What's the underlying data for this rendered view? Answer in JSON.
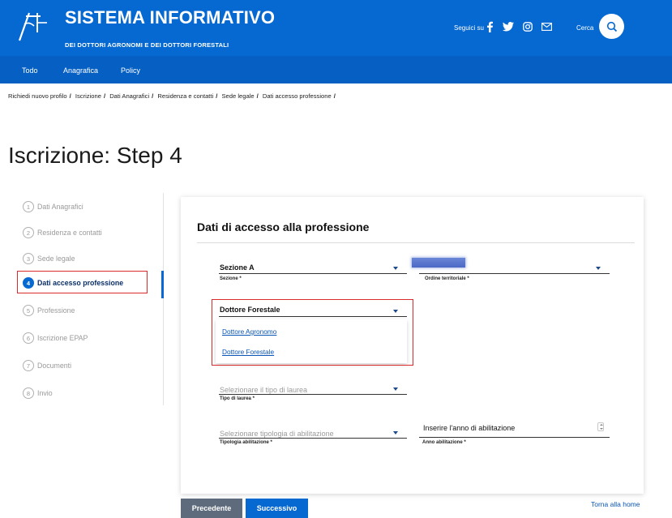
{
  "header": {
    "title": "SISTEMA INFORMATIVO",
    "subtitle": "DEI DOTTORI AGRONOMI E DEI DOTTORI FORESTALI",
    "social_label": "Seguici su",
    "social_icons": [
      "facebook-icon",
      "twitter-icon",
      "instagram-icon",
      "mail-icon"
    ],
    "search_label": "Cerca",
    "search_icon": "search-icon",
    "nav": [
      "Todo",
      "Anagrafica",
      "Policy"
    ],
    "colors": {
      "brand": "#0668d1",
      "nav": "#0660c4"
    }
  },
  "breadcrumb": [
    "Richiedi nuovo profilo",
    "Iscrizione",
    "Dati Anagrafici",
    "Residenza e contatti",
    "Sede legale",
    "Dati accesso professione"
  ],
  "page_title": "Iscrizione: Step 4",
  "stepper": {
    "active_index": 3,
    "steps": [
      {
        "num": "1",
        "label": "Dati Anagrafici"
      },
      {
        "num": "2",
        "label": "Residenza e contatti"
      },
      {
        "num": "3",
        "label": "Sede legale"
      },
      {
        "num": "4",
        "label": "Dati accesso professione"
      },
      {
        "num": "5",
        "label": "Professione"
      },
      {
        "num": "6",
        "label": "Iscrizione EPAP"
      },
      {
        "num": "7",
        "label": "Documenti"
      },
      {
        "num": "8",
        "label": "Invio"
      }
    ]
  },
  "form": {
    "title": "Dati di accesso alla professione",
    "sezione": {
      "value": "Sezione A",
      "label": "Sezione *"
    },
    "ordine": {
      "value": "",
      "label": "Ordine territoriale *"
    },
    "titolo": {
      "value": "Dottore Forestale",
      "options": [
        "Dottore Agronomo",
        "Dottore Forestale"
      ]
    },
    "tipo_laurea": {
      "placeholder": "Selezionare il tipo di laurea",
      "label": "Tipo di laurea *"
    },
    "tipologia": {
      "placeholder": "Selezionare tipologia di abilitazione",
      "label": "Tipologia abilitazione *"
    },
    "anno": {
      "placeholder": "Inserire l'anno di abilitazione",
      "label": "Anno abilitazione *"
    }
  },
  "buttons": {
    "prev": "Precedente",
    "next": "Successivo",
    "home": "Torna alla home"
  },
  "highlight_color": "#d92b2b"
}
